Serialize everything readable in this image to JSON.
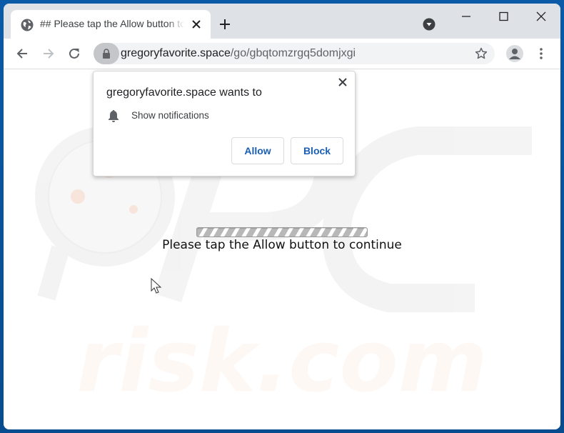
{
  "browser": {
    "tab": {
      "title": "## Please tap the Allow button to continue",
      "favicon": "globe-icon"
    },
    "new_tab_label": "+",
    "window_controls": [
      "minimize-icon",
      "maximize-icon",
      "close-icon"
    ],
    "address_bar": {
      "domain": "gregoryfavorite.space",
      "path": "/go/gbqtomzrgq5domjxgi",
      "security_icon": "lock-icon"
    },
    "toolbar_icons": [
      "back-icon",
      "forward-icon",
      "reload-icon",
      "star-icon",
      "profile-icon",
      "menu-icon"
    ]
  },
  "permission_prompt": {
    "title": "gregoryfavorite.space wants to",
    "permission": "Show notifications",
    "permission_icon": "bell-icon",
    "allow_label": "Allow",
    "block_label": "Block"
  },
  "page": {
    "message": "Please tap the Allow button to continue",
    "watermark": "PC risk.com"
  },
  "colors": {
    "desktop": "#0a5aa8",
    "tabstrip": "#dee1e6",
    "button_text": "#1a5fb4"
  }
}
